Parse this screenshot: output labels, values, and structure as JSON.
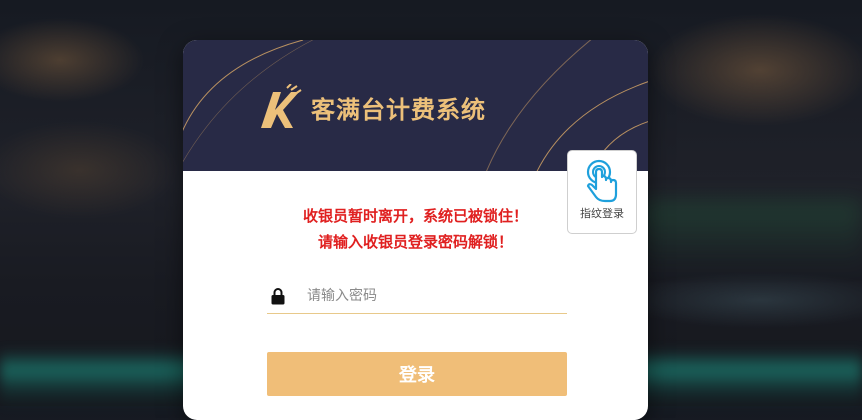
{
  "app": {
    "title": "客满台计费系统",
    "logo_letter": "K",
    "brand_color": "#ecc07a",
    "header_color": "#282a46"
  },
  "lock_message": {
    "line1": "收银员暂时离开，系统已被锁住！",
    "line2": "请输入收银员登录密码解锁！",
    "color": "#e02020"
  },
  "password": {
    "placeholder": "请输入密码",
    "value": "",
    "icon": "lock-icon"
  },
  "login": {
    "label": "登录",
    "color": "#f0be78"
  },
  "fingerprint": {
    "label": "指纹登录",
    "icon": "tap-hand-icon",
    "icon_color": "#1ea0dc"
  }
}
